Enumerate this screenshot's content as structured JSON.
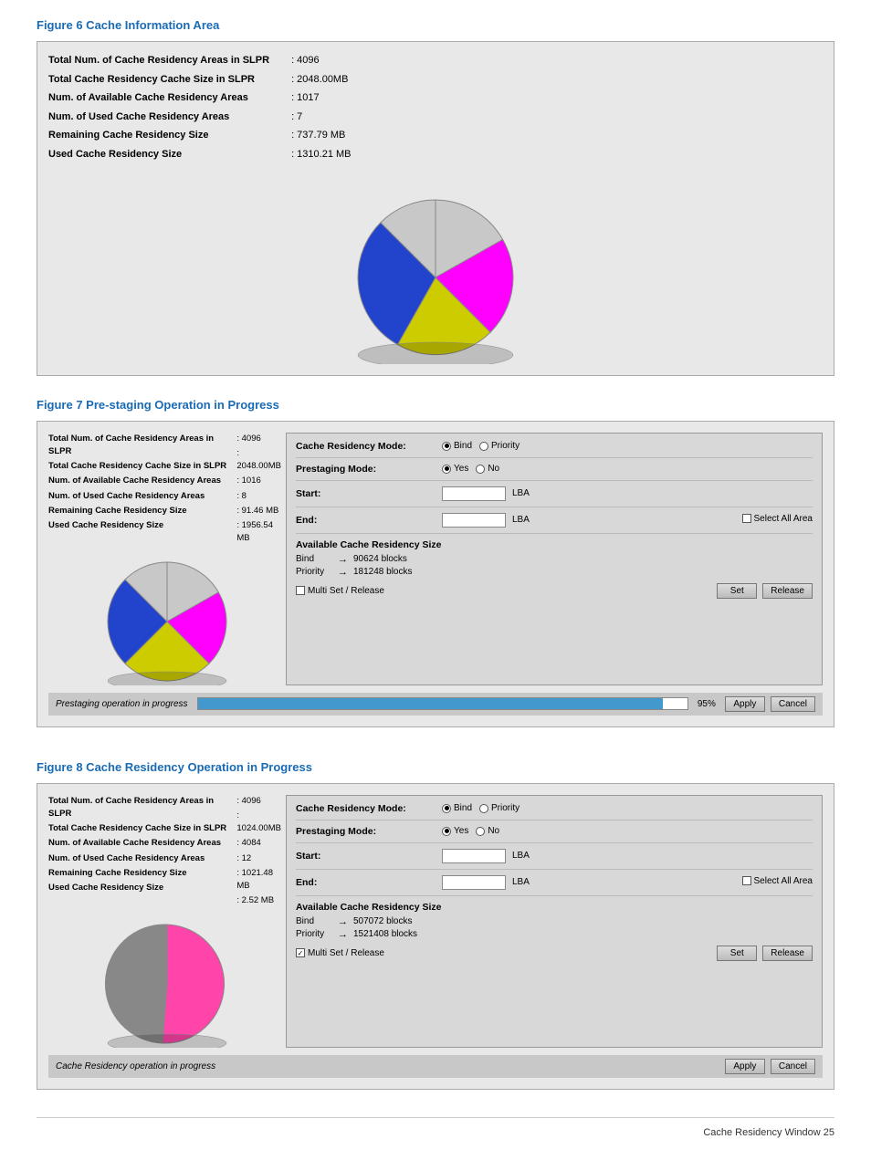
{
  "fig6": {
    "title": "Figure 6 Cache Information Area",
    "stats": [
      {
        "label": "Total Num. of Cache Residency Areas in SLPR",
        "value": ": 4096"
      },
      {
        "label": "Total Cache Residency Cache Size in SLPR",
        "value": ": 2048.00MB"
      },
      {
        "label": "Num. of Available Cache Residency Areas",
        "value": ": 1017"
      },
      {
        "label": "Num. of Used Cache Residency Areas",
        "value": ": 7"
      },
      {
        "label": "Remaining Cache Residency Size",
        "value": ": 737.79 MB"
      },
      {
        "label": "Used Cache Residency Size",
        "value": ": 1310.21 MB"
      }
    ]
  },
  "fig7": {
    "title": "Figure 7 Pre-staging Operation in Progress",
    "stats": [
      {
        "label": "Total Num. of Cache Residency Areas in SLPR",
        "value": ": 4096"
      },
      {
        "label": "Total Cache Residency Cache Size in SLPR",
        "value": ": 2048.00MB"
      },
      {
        "label": "Num. of Available Cache Residency Areas",
        "value": ": 1016"
      },
      {
        "label": "Num. of Used Cache Residency Areas",
        "value": ": 8"
      },
      {
        "label": "Remaining Cache Residency Size",
        "value": ": 91.46 MB"
      },
      {
        "label": "Used Cache Residency Size",
        "value": ": 1956.54 MB"
      }
    ],
    "right": {
      "cache_residency_mode_label": "Cache Residency Mode:",
      "mode_bind_selected": "Bind",
      "mode_priority": "Priority",
      "prestaging_mode_label": "Prestaging Mode:",
      "pre_yes": "Yes",
      "pre_no": "No",
      "start_label": "Start:",
      "end_label": "End:",
      "lba": "LBA",
      "select_all_area": "Select All Area",
      "avail_title": "Available Cache Residency Size",
      "bind_label": "Bind",
      "bind_arrow": "→",
      "bind_value": "90624 blocks",
      "priority_label": "Priority",
      "priority_arrow": "→",
      "priority_value": "181248 blocks",
      "multi_set_label": "Multi Set / Release",
      "multi_set_checked": false,
      "set_btn": "Set",
      "release_btn": "Release"
    },
    "status_label": "Prestaging operation in progress",
    "progress": 95,
    "progress_text": "95%",
    "apply_btn": "Apply",
    "cancel_btn": "Cancel"
  },
  "fig8": {
    "title": "Figure 8 Cache Residency Operation in Progress",
    "stats": [
      {
        "label": "Total Num. of Cache Residency Areas in SLPR",
        "value": ": 4096"
      },
      {
        "label": "Total Cache Residency Cache Size in SLPR",
        "value": ": 1024.00MB"
      },
      {
        "label": "Num. of Available Cache Residency Areas",
        "value": ": 4084"
      },
      {
        "label": "Num. of Used Cache Residency Areas",
        "value": ": 12"
      },
      {
        "label": "Remaining Cache Residency Size",
        "value": ": 1021.48 MB"
      },
      {
        "label": "Used Cache Residency Size",
        "value": ": 2.52 MB"
      }
    ],
    "right": {
      "cache_residency_mode_label": "Cache Residency Mode:",
      "mode_bind_selected": "Bind",
      "mode_priority": "Priority",
      "prestaging_mode_label": "Prestaging Mode:",
      "pre_yes": "Yes",
      "pre_no": "No",
      "start_label": "Start:",
      "end_label": "End:",
      "lba": "LBA",
      "select_all_area": "Select All Area",
      "avail_title": "Available Cache Residency Size",
      "bind_label": "Bind",
      "bind_arrow": "→",
      "bind_value": "507072 blocks",
      "priority_label": "Priority",
      "priority_arrow": "→",
      "priority_value": "1521408 blocks",
      "multi_set_label": "Multi Set / Release",
      "multi_set_checked": true,
      "set_btn": "Set",
      "release_btn": "Release"
    },
    "status_label": "Cache Residency operation in progress",
    "progress": 0,
    "progress_text": "",
    "apply_btn": "Apply",
    "cancel_btn": "Cancel"
  },
  "footer": {
    "text": "Cache Residency Window   25"
  }
}
